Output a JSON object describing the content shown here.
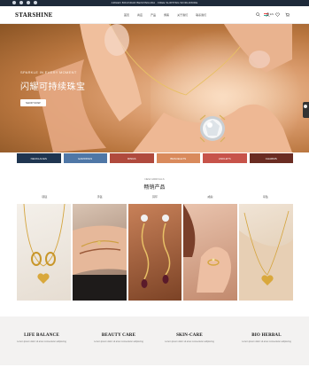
{
  "topbar": {
    "promo": "ARGEN BOUNDAR BENVINGUDA · FREE SHIPPING WORLDWIDE",
    "socials": [
      "facebook-icon",
      "twitter-icon",
      "pinterest-icon",
      "instagram-icon"
    ]
  },
  "header": {
    "logo": "STARSHINE",
    "menu": [
      "首页",
      "商店",
      "产品",
      "博客",
      "关于我们",
      "联系我们"
    ],
    "lang": "EN"
  },
  "hero": {
    "subtitle": "SPARKLE IN EVERY MOMENT",
    "title": "闪耀可持续珠宝",
    "button": "SHOP NOW"
  },
  "categories": [
    {
      "label": "NECKLACES",
      "color": "#1f3550"
    },
    {
      "label": "EARRINGS",
      "color": "#4f77a6"
    },
    {
      "label": "RINGS",
      "color": "#b04a3d"
    },
    {
      "label": "BRACELETS",
      "color": "#d98a5c"
    },
    {
      "label": "ANKLETS",
      "color": "#c7534a"
    },
    {
      "label": "CHARMS",
      "color": "#6a2c22"
    }
  ],
  "section": {
    "subtitle": "NEW ARRIVALS",
    "title": "畅销产品",
    "tabs": [
      "项链",
      "手链",
      "耳环",
      "戒指",
      "吊坠"
    ]
  },
  "features": [
    {
      "title": "LIFE BALANCE",
      "desc": "Lorem ipsum dolor sit amet consectetur adipiscing"
    },
    {
      "title": "BEAUTY CARE",
      "desc": "Lorem ipsum dolor sit amet consectetur adipiscing"
    },
    {
      "title": "SKIN-CARE",
      "desc": "Lorem ipsum dolor sit amet consectetur adipiscing"
    },
    {
      "title": "BIO HERBAL",
      "desc": "Lorem ipsum dolor sit amet consectetur adipiscing"
    }
  ]
}
